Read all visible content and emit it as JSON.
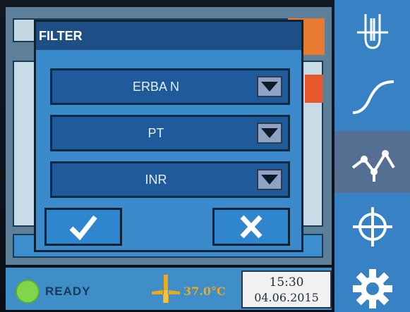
{
  "dialog": {
    "title": "FILTER",
    "dropdowns": [
      {
        "value": "ERBA N"
      },
      {
        "value": "PT"
      },
      {
        "value": "INR"
      }
    ]
  },
  "status": {
    "state_label": "READY",
    "temperature": "37.0°C",
    "time": "15:30",
    "date": "04.06.2015"
  },
  "sidebar": {
    "items": [
      {
        "icon": "cuvette-icon"
      },
      {
        "icon": "curve-icon"
      },
      {
        "icon": "graph-nodes-icon",
        "active": true
      },
      {
        "icon": "crosshair-icon"
      },
      {
        "icon": "gear-icon"
      }
    ]
  },
  "colors": {
    "accent": "#3b8acb",
    "titlebar": "#1d4f86",
    "ready": "#7fd64b",
    "temperature": "#f0a81a"
  }
}
